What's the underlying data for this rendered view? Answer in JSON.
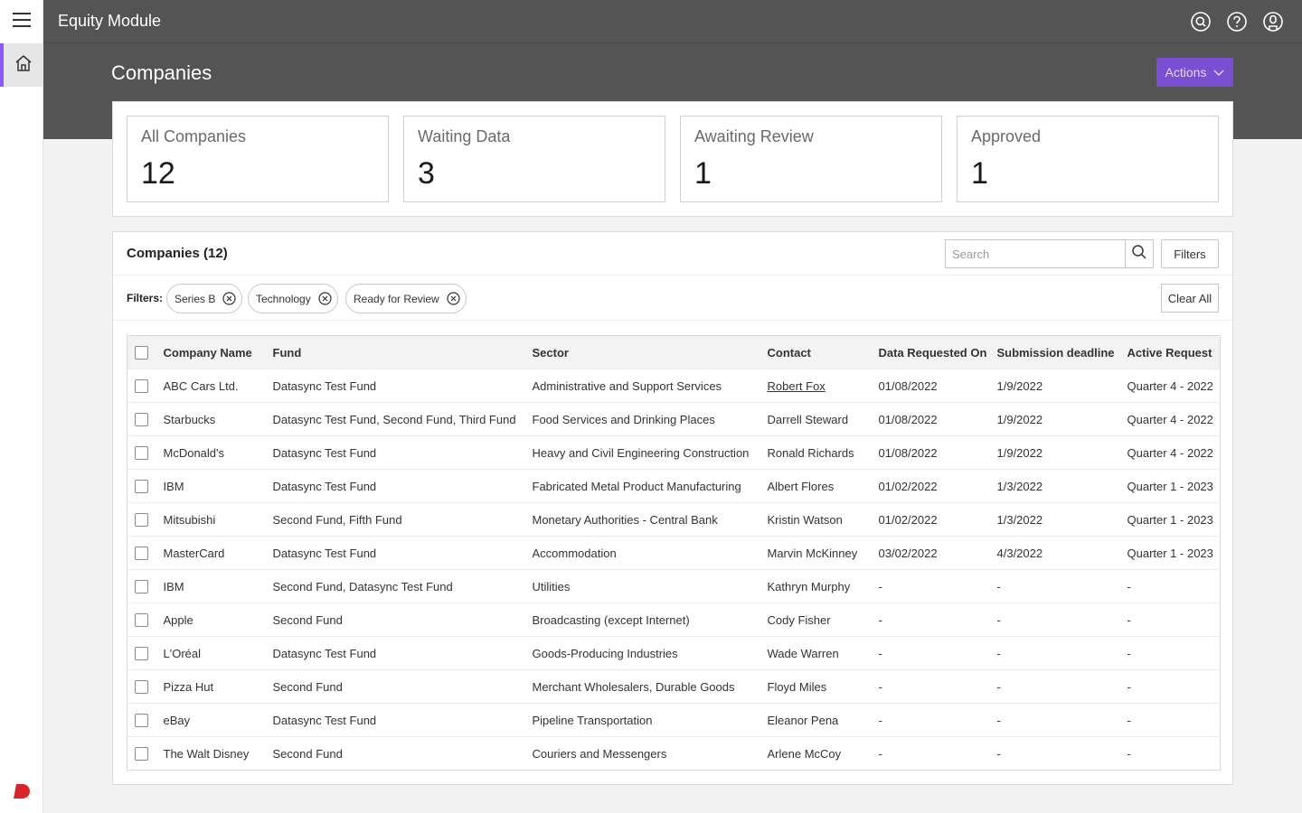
{
  "app": {
    "title": "Equity Module"
  },
  "page": {
    "title": "Companies",
    "actions_label": "Actions"
  },
  "stats": [
    {
      "label": "All Companies",
      "value": "12"
    },
    {
      "label": "Waiting Data",
      "value": "3"
    },
    {
      "label": "Awaiting Review",
      "value": "1"
    },
    {
      "label": "Approved",
      "value": "1"
    }
  ],
  "table_panel": {
    "title": "Companies (12)",
    "search_placeholder": "Search",
    "filters_label": "Filters",
    "filters_prefix": "Filters:",
    "chips": [
      "Series B",
      "Technology",
      "Ready for Review"
    ],
    "clear_all_label": "Clear All"
  },
  "table": {
    "columns": [
      "Company Name",
      "Fund",
      "Sector",
      "Contact",
      "Data Requested On",
      "Submission deadline",
      "Active Request"
    ],
    "rows": [
      {
        "company": "ABC Cars Ltd.",
        "fund": "Datasync Test Fund",
        "sector": "Administrative and Support Services",
        "contact": "Robert Fox",
        "requested": "01/08/2022",
        "deadline": "1/9/2022",
        "request": "Quarter 4 - 2022"
      },
      {
        "company": "Starbucks",
        "fund": "Datasync Test Fund, Second Fund, Third Fund",
        "sector": "Food Services and Drinking Places",
        "contact": "Darrell Steward",
        "requested": "01/08/2022",
        "deadline": "1/9/2022",
        "request": "Quarter 4 - 2022"
      },
      {
        "company": "McDonald's",
        "fund": "Datasync Test Fund",
        "sector": "Heavy and Civil Engineering Construction",
        "contact": "Ronald Richards",
        "requested": "01/08/2022",
        "deadline": "1/9/2022",
        "request": "Quarter 4 - 2022"
      },
      {
        "company": "IBM",
        "fund": "Datasync Test Fund",
        "sector": "Fabricated Metal Product Manufacturing",
        "contact": "Albert Flores",
        "requested": "01/02/2022",
        "deadline": "1/3/2022",
        "request": "Quarter 1 - 2023"
      },
      {
        "company": "Mitsubishi",
        "fund": "Second Fund, Fifth Fund",
        "sector": "Monetary Authorities - Central Bank",
        "contact": "Kristin Watson",
        "requested": "01/02/2022",
        "deadline": "1/3/2022",
        "request": "Quarter 1 - 2023"
      },
      {
        "company": "MasterCard",
        "fund": "Datasync Test Fund",
        "sector": "Accommodation",
        "contact": "Marvin McKinney",
        "requested": "03/02/2022",
        "deadline": "4/3/2022",
        "request": "Quarter 1 - 2023"
      },
      {
        "company": "IBM",
        "fund": "Second Fund, Datasync Test Fund",
        "sector": "Utilities",
        "contact": "Kathryn Murphy",
        "requested": "-",
        "deadline": "-",
        "request": "-"
      },
      {
        "company": "Apple",
        "fund": "Second Fund",
        "sector": "Broadcasting (except Internet)",
        "contact": "Cody Fisher",
        "requested": "-",
        "deadline": "-",
        "request": "-"
      },
      {
        "company": "L'Oréal",
        "fund": "Datasync Test Fund",
        "sector": "Goods-Producing Industries",
        "contact": "Wade Warren",
        "requested": "-",
        "deadline": "-",
        "request": "-"
      },
      {
        "company": "Pizza Hut",
        "fund": "Second Fund",
        "sector": "Merchant Wholesalers, Durable Goods",
        "contact": "Floyd Miles",
        "requested": "-",
        "deadline": "-",
        "request": "-"
      },
      {
        "company": "eBay",
        "fund": "Datasync Test Fund",
        "sector": "Pipeline Transportation",
        "contact": "Eleanor Pena",
        "requested": "-",
        "deadline": "-",
        "request": "-"
      },
      {
        "company": "The Walt Disney",
        "fund": "Second Fund",
        "sector": "Couriers and Messengers",
        "contact": "Arlene McCoy",
        "requested": "-",
        "deadline": "-",
        "request": "-"
      }
    ]
  },
  "icons": {
    "menu": "hamburger-menu-icon",
    "home": "home-icon",
    "search_header": "search-icon",
    "help": "help-icon",
    "user": "user-icon",
    "brand": "brand-logo",
    "chip_close": "close-circle-icon",
    "chevron": "chevron-down-icon"
  },
  "colors": {
    "header": "#545454",
    "accent": "#7b4fd1",
    "rail_active": "#8a5cf6",
    "brand": "#d9252a"
  }
}
